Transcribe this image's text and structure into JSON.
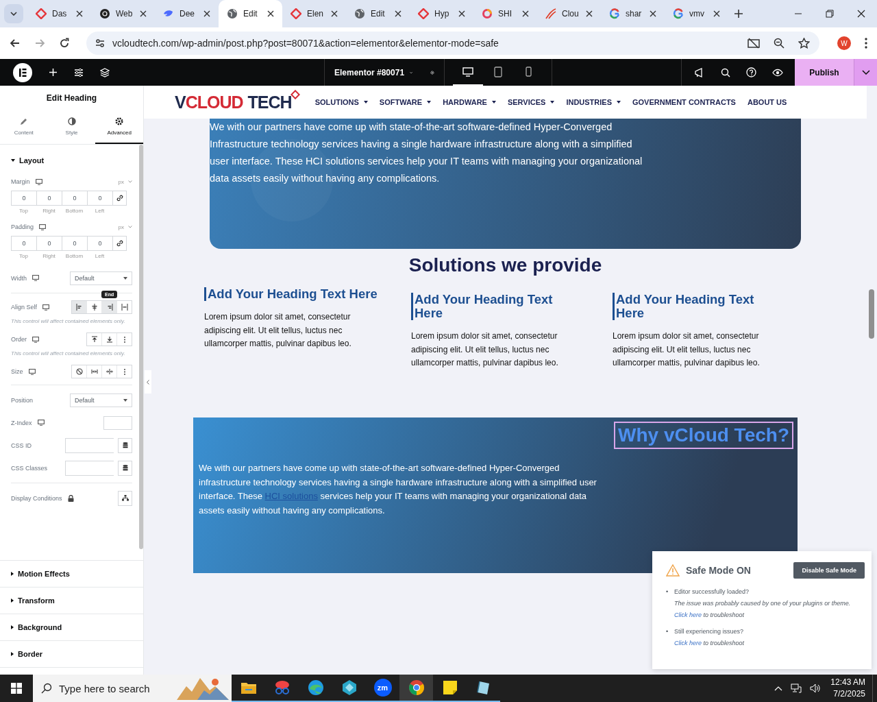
{
  "browser": {
    "tabs": [
      {
        "title": "Das",
        "selected": false,
        "kind": "diamond"
      },
      {
        "title": "Web",
        "selected": false,
        "kind": "dark"
      },
      {
        "title": "Dee",
        "selected": false,
        "kind": "whale"
      },
      {
        "title": "Edit",
        "selected": true,
        "kind": "globe"
      },
      {
        "title": "Elen",
        "selected": false,
        "kind": "diamond"
      },
      {
        "title": "Edit",
        "selected": false,
        "kind": "globe"
      },
      {
        "title": "Hyp",
        "selected": false,
        "kind": "diamond"
      },
      {
        "title": "SHI",
        "selected": false,
        "kind": "ring"
      },
      {
        "title": "Clou",
        "selected": false,
        "kind": "swoosh"
      },
      {
        "title": "shar",
        "selected": false,
        "kind": "g"
      },
      {
        "title": "vmv",
        "selected": false,
        "kind": "g"
      }
    ],
    "url": "vcloudtech.com/wp-admin/post.php?post=80071&action=elementor&elementor-mode=safe",
    "profile": "W"
  },
  "editor_bar": {
    "document": "Elementor #80071",
    "devices": [
      {
        "kind": "desktop",
        "selected": true
      },
      {
        "kind": "tablet",
        "selected": false
      },
      {
        "kind": "mobile",
        "selected": false
      }
    ],
    "publish": "Publish"
  },
  "panel": {
    "title": "Edit Heading",
    "tabs": [
      {
        "label": "Content",
        "kind": "pencil",
        "selected": false
      },
      {
        "label": "Style",
        "kind": "contrast",
        "selected": false
      },
      {
        "label": "Advanced",
        "kind": "gear",
        "selected": true
      }
    ],
    "sections": [
      {
        "title": "Layout",
        "expanded": true
      },
      {
        "title": "Motion Effects",
        "expanded": false
      },
      {
        "title": "Transform",
        "expanded": false
      },
      {
        "title": "Background",
        "expanded": false
      },
      {
        "title": "Border",
        "expanded": false
      }
    ],
    "margin": {
      "label": "Margin",
      "unit": "px",
      "values": [
        "0",
        "0",
        "0",
        "0"
      ],
      "sides": [
        "Top",
        "Right",
        "Bottom",
        "Left"
      ]
    },
    "padding": {
      "label": "Padding",
      "unit": "px",
      "values": [
        "0",
        "0",
        "0",
        "0"
      ],
      "sides": [
        "Top",
        "Right",
        "Bottom",
        "Left"
      ]
    },
    "width": {
      "label": "Width",
      "value": "Default"
    },
    "align_self": {
      "label": "Align Self",
      "tooltip": "End",
      "note": "This control will affect contained elements only.",
      "options": [
        {
          "kind": "start",
          "selected": true,
          "hovered": false
        },
        {
          "kind": "center",
          "selected": false,
          "hovered": false
        },
        {
          "kind": "end",
          "selected": false,
          "hovered": true
        },
        {
          "kind": "stretch",
          "selected": false,
          "hovered": false
        }
      ]
    },
    "order": {
      "label": "Order",
      "note": "This control will affect contained elements only.",
      "options": [
        {
          "kind": "top"
        },
        {
          "kind": "bottom"
        },
        {
          "kind": "more"
        }
      ]
    },
    "size": {
      "label": "Size",
      "options": [
        {
          "kind": "none"
        },
        {
          "kind": "grow"
        },
        {
          "kind": "shrink"
        },
        {
          "kind": "more"
        }
      ]
    },
    "position": {
      "label": "Position",
      "value": "Default"
    },
    "z_index": {
      "label": "Z-Index"
    },
    "css_id": {
      "label": "CSS ID"
    },
    "css_classes": {
      "label": "CSS Classes"
    },
    "display_conditions": {
      "label": "Display Conditions"
    }
  },
  "page": {
    "logo": [
      {
        "text": "V",
        "color": "#1f2a4d",
        "gap_before": false
      },
      {
        "text": "CLOUD",
        "color": "#d42a35",
        "gap_before": false
      },
      {
        "text": "TECH",
        "color": "#1f2a4d",
        "gap_before": true
      }
    ],
    "nav": [
      {
        "label": "SOLUTIONS",
        "dropdown": true
      },
      {
        "label": "SOFTWARE",
        "dropdown": true
      },
      {
        "label": "HARDWARE",
        "dropdown": true
      },
      {
        "label": "SERVICES",
        "dropdown": true
      },
      {
        "label": "INDUSTRIES",
        "dropdown": true
      },
      {
        "label": "GOVERNMENT CONTRACTS",
        "dropdown": false
      },
      {
        "label": "ABOUT US",
        "dropdown": false
      }
    ],
    "hero_text": "We with our partners have come up with state-of-the-art software-defined Hyper-Converged Infrastructure technology services having a single hardware infrastructure along with a simplified user interface. These HCI solutions services help your IT teams with managing your organizational data assets easily without having any complications.",
    "solutions_heading": "Solutions we provide",
    "columns": [
      {
        "heading": "Add Your Heading Text Here",
        "text": "Lorem ipsum dolor sit amet, consectetur adipiscing elit. Ut elit tellus, luctus nec ullamcorper mattis, pulvinar dapibus leo."
      },
      {
        "heading": "Add Your Heading Text Here",
        "text": "Lorem ipsum dolor sit amet, consectetur adipiscing elit. Ut elit tellus, luctus nec ullamcorper mattis, pulvinar dapibus leo."
      },
      {
        "heading": "Add Your Heading Text Here",
        "text": "Lorem ipsum dolor sit amet, consectetur adipiscing elit. Ut elit tellus, luctus nec ullamcorper mattis, pulvinar dapibus leo."
      }
    ],
    "why": {
      "heading": "Why vCloud Tech?",
      "selected": true,
      "before": "We with our partners have come up with state-of-the-art software-defined Hyper-Converged infrastructure technology services having a single hardware infrastructure along with a simplified user interface. These ",
      "link": "HCI solutions",
      "after": " services help your IT teams with managing your organizational data assets easily without having any complications."
    }
  },
  "safe_mode": {
    "title": "Safe Mode ON",
    "button": "Disable Safe Mode",
    "items": [
      {
        "marker": "•",
        "question": "Editor successfully loaded?",
        "before": "The issue was probably caused by one of your plugins or theme. ",
        "link": "Click here",
        "after": " to troubleshoot"
      },
      {
        "marker": "•",
        "question": "Still experiencing issues?",
        "link": "Click here",
        "after": " to troubleshoot"
      }
    ]
  },
  "taskbar": {
    "search_placeholder": "Type here to search",
    "apps": [
      {
        "kind": "folder",
        "selected": false
      },
      {
        "kind": "snip",
        "selected": false
      },
      {
        "kind": "edge",
        "selected": false
      },
      {
        "kind": "cube",
        "selected": false
      },
      {
        "kind": "zoom",
        "label": "zm",
        "selected": false
      },
      {
        "kind": "chrome",
        "selected": true
      },
      {
        "kind": "sticky",
        "selected": false
      },
      {
        "kind": "book",
        "selected": false
      }
    ],
    "time": "12:43 AM",
    "date": "7/2/2025"
  }
}
